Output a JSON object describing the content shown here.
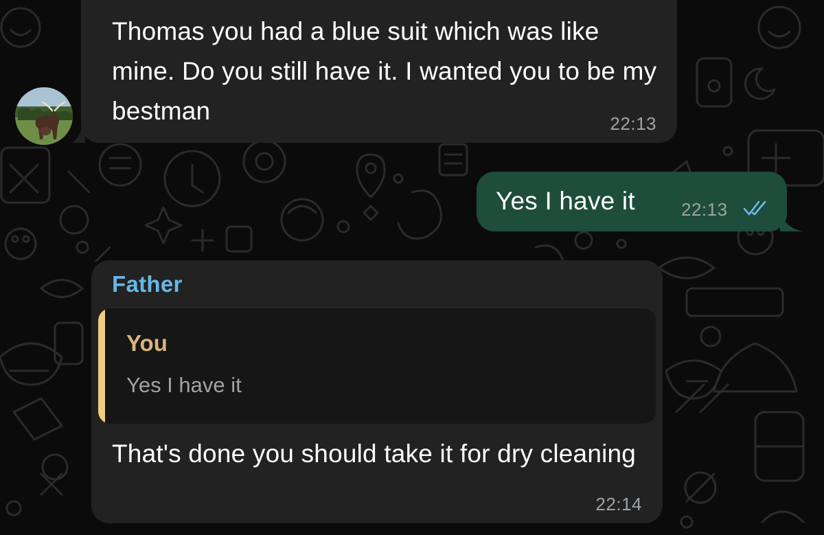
{
  "contact": {
    "avatar_icon": "avatar-cow-photo"
  },
  "messages": [
    {
      "direction": "incoming",
      "text": "Thomas you had a blue suit which was like mine. Do you still have it. I wanted you to be my bestman",
      "time": "22:13"
    },
    {
      "direction": "outgoing",
      "text": "Yes I have it",
      "time": "22:13",
      "status_icon": "double-check-read-icon"
    },
    {
      "direction": "incoming",
      "sender": "Father",
      "reply": {
        "author": "You",
        "text": "Yes I have it"
      },
      "text": "That's done you should take it for dry cleaning",
      "time": "22:14"
    }
  ],
  "colors": {
    "background": "#0b0b0b",
    "incoming_bubble": "#222222",
    "outgoing_bubble": "#1e4d3b",
    "sender_name": "#66b8e6",
    "quote_bar": "#f0cc82",
    "quote_author": "#d9b57a",
    "read_ticks": "#6fb8e8"
  }
}
